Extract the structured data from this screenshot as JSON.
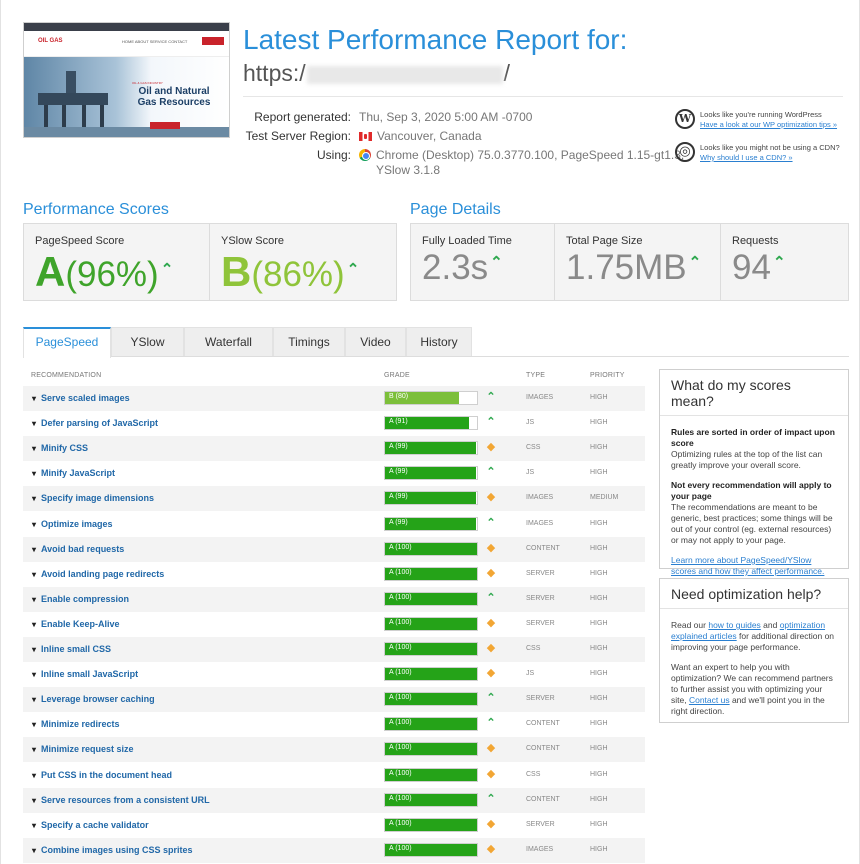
{
  "thumbnail": {
    "logo": "OIL GAS",
    "nav": "HOME   ABOUT   SERVICE   CONTACT",
    "tagline": "OIL & GAS INDUSTRY",
    "headline": "Oil and Natural Gas Resources"
  },
  "header": {
    "title": "Latest Performance Report for:",
    "url_prefix": "https:/",
    "url_suffix": "/"
  },
  "meta": {
    "generated_label": "Report generated:",
    "generated_value": "Thu, Sep 3, 2020 5:00 AM -0700",
    "region_label": "Test Server Region:",
    "region_value": "Vancouver, Canada",
    "using_label": "Using:",
    "using_line1": "Chrome (Desktop) 75.0.3770.100, PageSpeed 1.15-gt1.3,",
    "using_line2": "YSlow 3.1.8"
  },
  "tips": {
    "wp_text": "Looks like you're running WordPress",
    "wp_link": "Have a look at our WP optimization tips »",
    "cdn_text": "Looks like you might not be using a CDN?",
    "cdn_link": "Why should I use a CDN? »"
  },
  "performance": {
    "title": "Performance Scores",
    "pagespeed_label": "PageSpeed Score",
    "pagespeed_grade": "A",
    "pagespeed_pct": "(96%)",
    "yslow_label": "YSlow Score",
    "yslow_grade": "B",
    "yslow_pct": "(86%)"
  },
  "details": {
    "title": "Page Details",
    "loaded_label": "Fully Loaded Time",
    "loaded_value": "2.3s",
    "size_label": "Total Page Size",
    "size_value": "1.75MB",
    "requests_label": "Requests",
    "requests_value": "94"
  },
  "tabs": [
    "PageSpeed",
    "YSlow",
    "Waterfall",
    "Timings",
    "Video",
    "History"
  ],
  "table": {
    "headers": {
      "recommendation": "RECOMMENDATION",
      "grade": "GRADE",
      "type": "TYPE",
      "priority": "PRIORITY"
    },
    "rows": [
      {
        "name": "Serve scaled images",
        "grade": "B (80)",
        "score": 80,
        "trend": "up",
        "type": "IMAGES",
        "priority": "HIGH"
      },
      {
        "name": "Defer parsing of JavaScript",
        "grade": "A (91)",
        "score": 91,
        "trend": "up",
        "type": "JS",
        "priority": "HIGH"
      },
      {
        "name": "Minify CSS",
        "grade": "A (99)",
        "score": 99,
        "trend": "same",
        "type": "CSS",
        "priority": "HIGH"
      },
      {
        "name": "Minify JavaScript",
        "grade": "A (99)",
        "score": 99,
        "trend": "up",
        "type": "JS",
        "priority": "HIGH"
      },
      {
        "name": "Specify image dimensions",
        "grade": "A (99)",
        "score": 99,
        "trend": "same",
        "type": "IMAGES",
        "priority": "MEDIUM"
      },
      {
        "name": "Optimize images",
        "grade": "A (99)",
        "score": 99,
        "trend": "up",
        "type": "IMAGES",
        "priority": "HIGH"
      },
      {
        "name": "Avoid bad requests",
        "grade": "A (100)",
        "score": 100,
        "trend": "same",
        "type": "CONTENT",
        "priority": "HIGH"
      },
      {
        "name": "Avoid landing page redirects",
        "grade": "A (100)",
        "score": 100,
        "trend": "same",
        "type": "SERVER",
        "priority": "HIGH"
      },
      {
        "name": "Enable compression",
        "grade": "A (100)",
        "score": 100,
        "trend": "up",
        "type": "SERVER",
        "priority": "HIGH"
      },
      {
        "name": "Enable Keep-Alive",
        "grade": "A (100)",
        "score": 100,
        "trend": "same",
        "type": "SERVER",
        "priority": "HIGH"
      },
      {
        "name": "Inline small CSS",
        "grade": "A (100)",
        "score": 100,
        "trend": "same",
        "type": "CSS",
        "priority": "HIGH"
      },
      {
        "name": "Inline small JavaScript",
        "grade": "A (100)",
        "score": 100,
        "trend": "same",
        "type": "JS",
        "priority": "HIGH"
      },
      {
        "name": "Leverage browser caching",
        "grade": "A (100)",
        "score": 100,
        "trend": "up",
        "type": "SERVER",
        "priority": "HIGH"
      },
      {
        "name": "Minimize redirects",
        "grade": "A (100)",
        "score": 100,
        "trend": "up",
        "type": "CONTENT",
        "priority": "HIGH"
      },
      {
        "name": "Minimize request size",
        "grade": "A (100)",
        "score": 100,
        "trend": "same",
        "type": "CONTENT",
        "priority": "HIGH"
      },
      {
        "name": "Put CSS in the document head",
        "grade": "A (100)",
        "score": 100,
        "trend": "same",
        "type": "CSS",
        "priority": "HIGH"
      },
      {
        "name": "Serve resources from a consistent URL",
        "grade": "A (100)",
        "score": 100,
        "trend": "up",
        "type": "CONTENT",
        "priority": "HIGH"
      },
      {
        "name": "Specify a cache validator",
        "grade": "A (100)",
        "score": 100,
        "trend": "same",
        "type": "SERVER",
        "priority": "HIGH"
      },
      {
        "name": "Combine images using CSS sprites",
        "grade": "A (100)",
        "score": 100,
        "trend": "same",
        "type": "IMAGES",
        "priority": "HIGH"
      }
    ]
  },
  "sidebar": {
    "scores_title": "What do my scores mean?",
    "scores_b1": "Rules are sorted in order of impact upon score",
    "scores_t1": "Optimizing rules at the top of the list can greatly improve your overall score.",
    "scores_b2": "Not every recommendation will apply to your page",
    "scores_t2": "The recommendations are meant to be generic, best practices; some things will be out of your control (eg. external resources) or may not apply to your page.",
    "scores_link": "Learn more about PageSpeed/YSlow scores and how they affect performance.",
    "help_title": "Need optimization help?",
    "help_t1a": "Read our ",
    "help_link1": "how to guides",
    "help_t1b": " and ",
    "help_link2": "optimization explained articles",
    "help_t1c": " for additional direction on improving your page performance.",
    "help_t2a": "Want an expert to help you with optimization? We can recommend partners to further assist you with optimizing your site, ",
    "help_link3": "Contact us",
    "help_t2b": " and we'll point you in the right direction."
  },
  "colors": {
    "accent": "#2a8fd9",
    "grade_a": "#3fa42b",
    "grade_b": "#8fc43a",
    "bar_a": "#25a318",
    "trend_up": "#2fa84f",
    "trend_same": "#f2a634"
  }
}
